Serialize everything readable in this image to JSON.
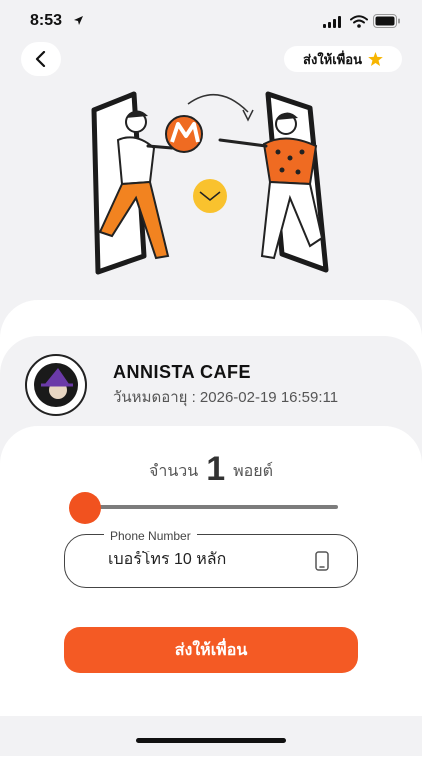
{
  "status_bar": {
    "time": "8:53"
  },
  "header": {
    "share_label": "ส่งให้เพื่อน"
  },
  "shop": {
    "name": "ANNISTA CAFE",
    "expiry": "วันหมดอายุ : 2026-02-19 16:59:11",
    "logo_text": "ANNISTA CAFE"
  },
  "points": {
    "label": "จำนวน",
    "value": "1",
    "unit": "พอยต์",
    "selected_fraction": 0
  },
  "phone": {
    "label": "Phone Number",
    "placeholder": "เบอร์โทร 10 หลัก",
    "value": ""
  },
  "actions": {
    "send_label": "ส่งให้เพื่อน"
  },
  "colors": {
    "accent": "#f45a24",
    "star": "#f7b500",
    "background": "#f2f2f4"
  }
}
